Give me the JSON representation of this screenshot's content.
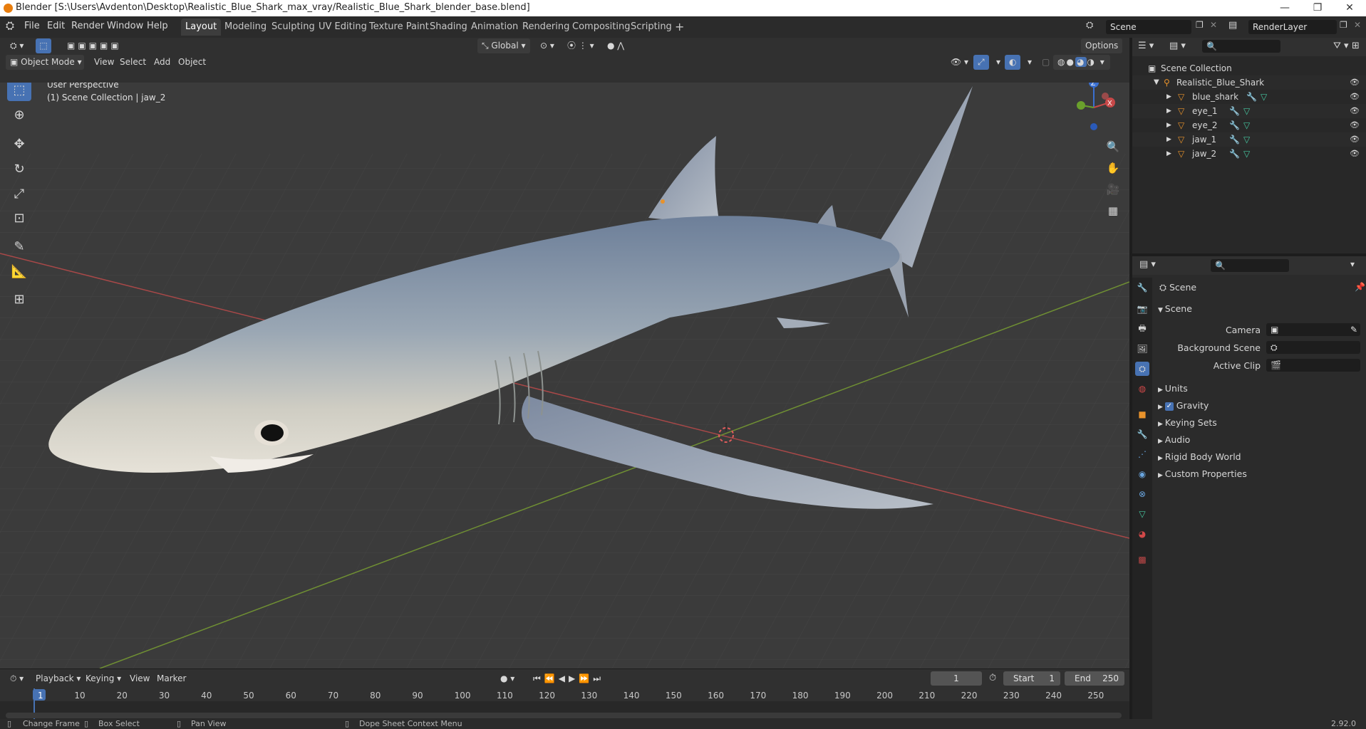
{
  "window": {
    "title": "Blender [S:\\Users\\Avdenton\\Desktop\\Realistic_Blue_Shark_max_vray/Realistic_Blue_Shark_blender_base.blend]",
    "minimize": "—",
    "maximize": "❐",
    "close": "✕"
  },
  "menus": [
    "File",
    "Edit",
    "Render",
    "Window",
    "Help"
  ],
  "workspace_tabs": [
    "Layout",
    "Modeling",
    "Sculpting",
    "UV Editing",
    "Texture Paint",
    "Shading",
    "Animation",
    "Rendering",
    "Compositing",
    "Scripting"
  ],
  "active_tab": "Layout",
  "add_tab": "+",
  "scene_field": "Scene",
  "render_layer": "RenderLayer",
  "viewport_header": {
    "transform_orientation": "Global",
    "options": "Options",
    "mode": "Object Mode",
    "menu": [
      "View",
      "Select",
      "Add",
      "Object"
    ]
  },
  "viewport_info": {
    "line1": "User Perspective",
    "line2": "(1) Scene Collection | jaw_2"
  },
  "gizmo": {
    "x": "X",
    "y": "Y",
    "z": "Z"
  },
  "outliner": {
    "root": "Scene Collection",
    "collection": "Realistic_Blue_Shark",
    "objects": [
      "blue_shark",
      "eye_1",
      "eye_2",
      "jaw_1",
      "jaw_2"
    ]
  },
  "properties": {
    "context": "Scene",
    "panel": "Scene",
    "fields": [
      {
        "label": "Camera"
      },
      {
        "label": "Background Scene"
      },
      {
        "label": "Active Clip"
      }
    ],
    "sections": [
      "Units",
      "Gravity",
      "Keying Sets",
      "Audio",
      "Rigid Body World",
      "Custom Properties"
    ],
    "gravity_checked": true
  },
  "timeline": {
    "menus": [
      "Playback",
      "Keying",
      "View",
      "Marker"
    ],
    "current_frame": "1",
    "start_label": "Start",
    "start": "1",
    "end_label": "End",
    "end": "250",
    "ticks": [
      "1",
      "10",
      "20",
      "30",
      "40",
      "50",
      "60",
      "70",
      "80",
      "90",
      "100",
      "110",
      "120",
      "130",
      "140",
      "150",
      "160",
      "170",
      "180",
      "190",
      "200",
      "210",
      "220",
      "230",
      "240",
      "250"
    ]
  },
  "status": {
    "items": [
      "Change Frame",
      "Box Select",
      "Pan View",
      "Dope Sheet Context Menu"
    ],
    "version": "2.92.0"
  },
  "colors": {
    "accent": "#4772b3",
    "background": "#3b3b3b",
    "panel": "#303030",
    "axis_x": "#e05c5c",
    "axis_y": "#8cba3c",
    "object_orange": "#e8922b"
  }
}
